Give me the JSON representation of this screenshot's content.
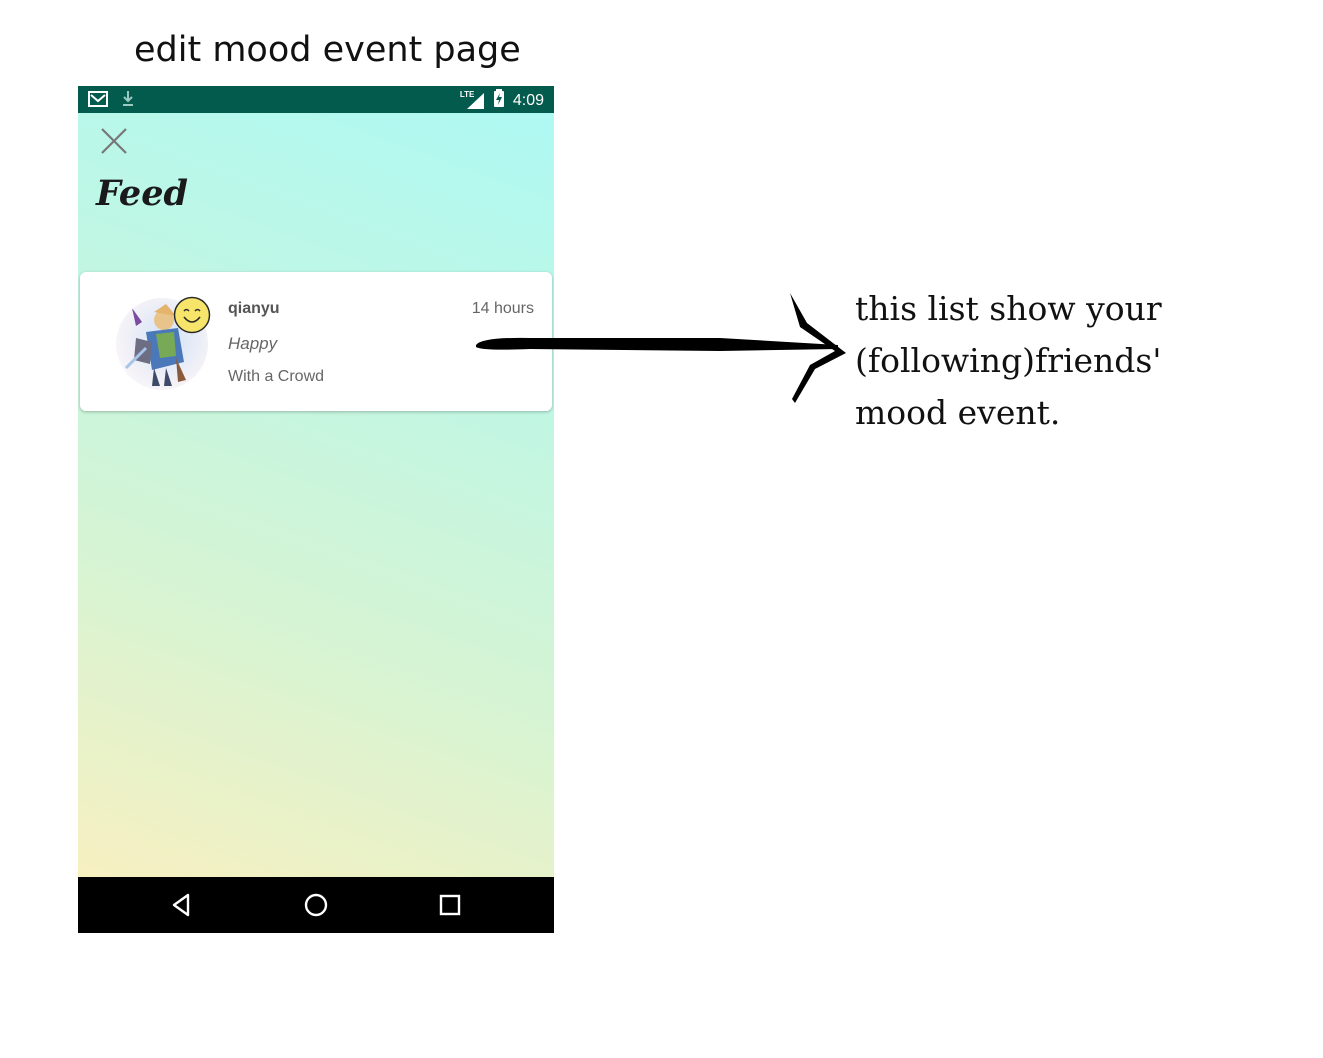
{
  "page_heading": "edit mood event page",
  "status_bar": {
    "icons": [
      "gmail-icon",
      "download-icon",
      "lte-signal-icon",
      "battery-charging-icon"
    ],
    "network_label": "LTE",
    "time": "4:09",
    "background": "#035b4d"
  },
  "screen": {
    "close_icon": "close-icon",
    "title": "Feed"
  },
  "feed": {
    "items": [
      {
        "username": "qianyu",
        "time_ago": "14 hours",
        "mood": "Happy",
        "situation": "With a Crowd",
        "mood_icon": "smiley-icon",
        "mood_color": "#f7e56b"
      }
    ]
  },
  "nav_bar": {
    "buttons": [
      "back-icon",
      "home-icon",
      "recents-icon"
    ]
  },
  "annotation": {
    "lines": [
      "this list show your",
      "(following)friends'",
      "mood event."
    ]
  }
}
